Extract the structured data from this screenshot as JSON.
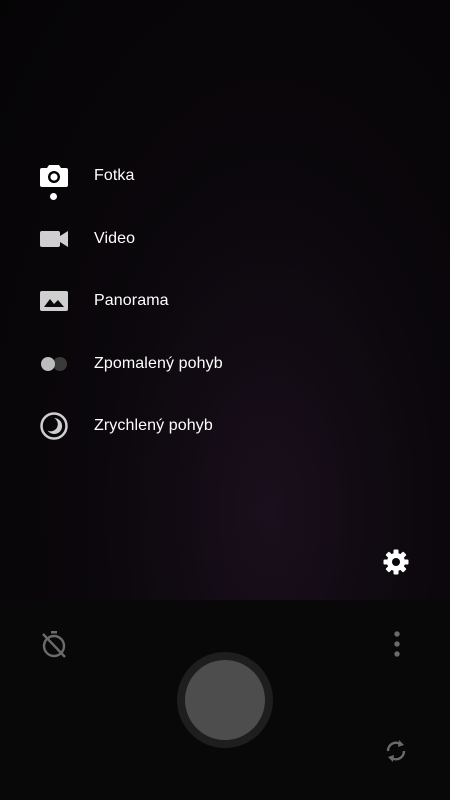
{
  "modes": [
    {
      "label": "Fotka",
      "icon": "camera-icon",
      "active": true
    },
    {
      "label": "Video",
      "icon": "video-camera-icon",
      "active": false
    },
    {
      "label": "Panorama",
      "icon": "panorama-icon",
      "active": false
    },
    {
      "label": "Zpomalený pohyb",
      "icon": "slow-motion-icon",
      "active": false
    },
    {
      "label": "Zrychlený pohyb",
      "icon": "time-lapse-icon",
      "active": false
    }
  ],
  "controls": {
    "settings_icon": "gear-icon",
    "timer_icon": "timer-off-icon",
    "more_icon": "more-vertical-icon",
    "shutter_icon": "shutter-button",
    "switch_camera_icon": "switch-camera-icon"
  },
  "colors": {
    "text": "#ffffff",
    "icon_active": "#ffffff",
    "icon_inactive": "#cfcfcf",
    "control_dim": "#6b6b6b",
    "shutter": "#4d4d4d",
    "shutter_ring": "#1e1e1e"
  }
}
